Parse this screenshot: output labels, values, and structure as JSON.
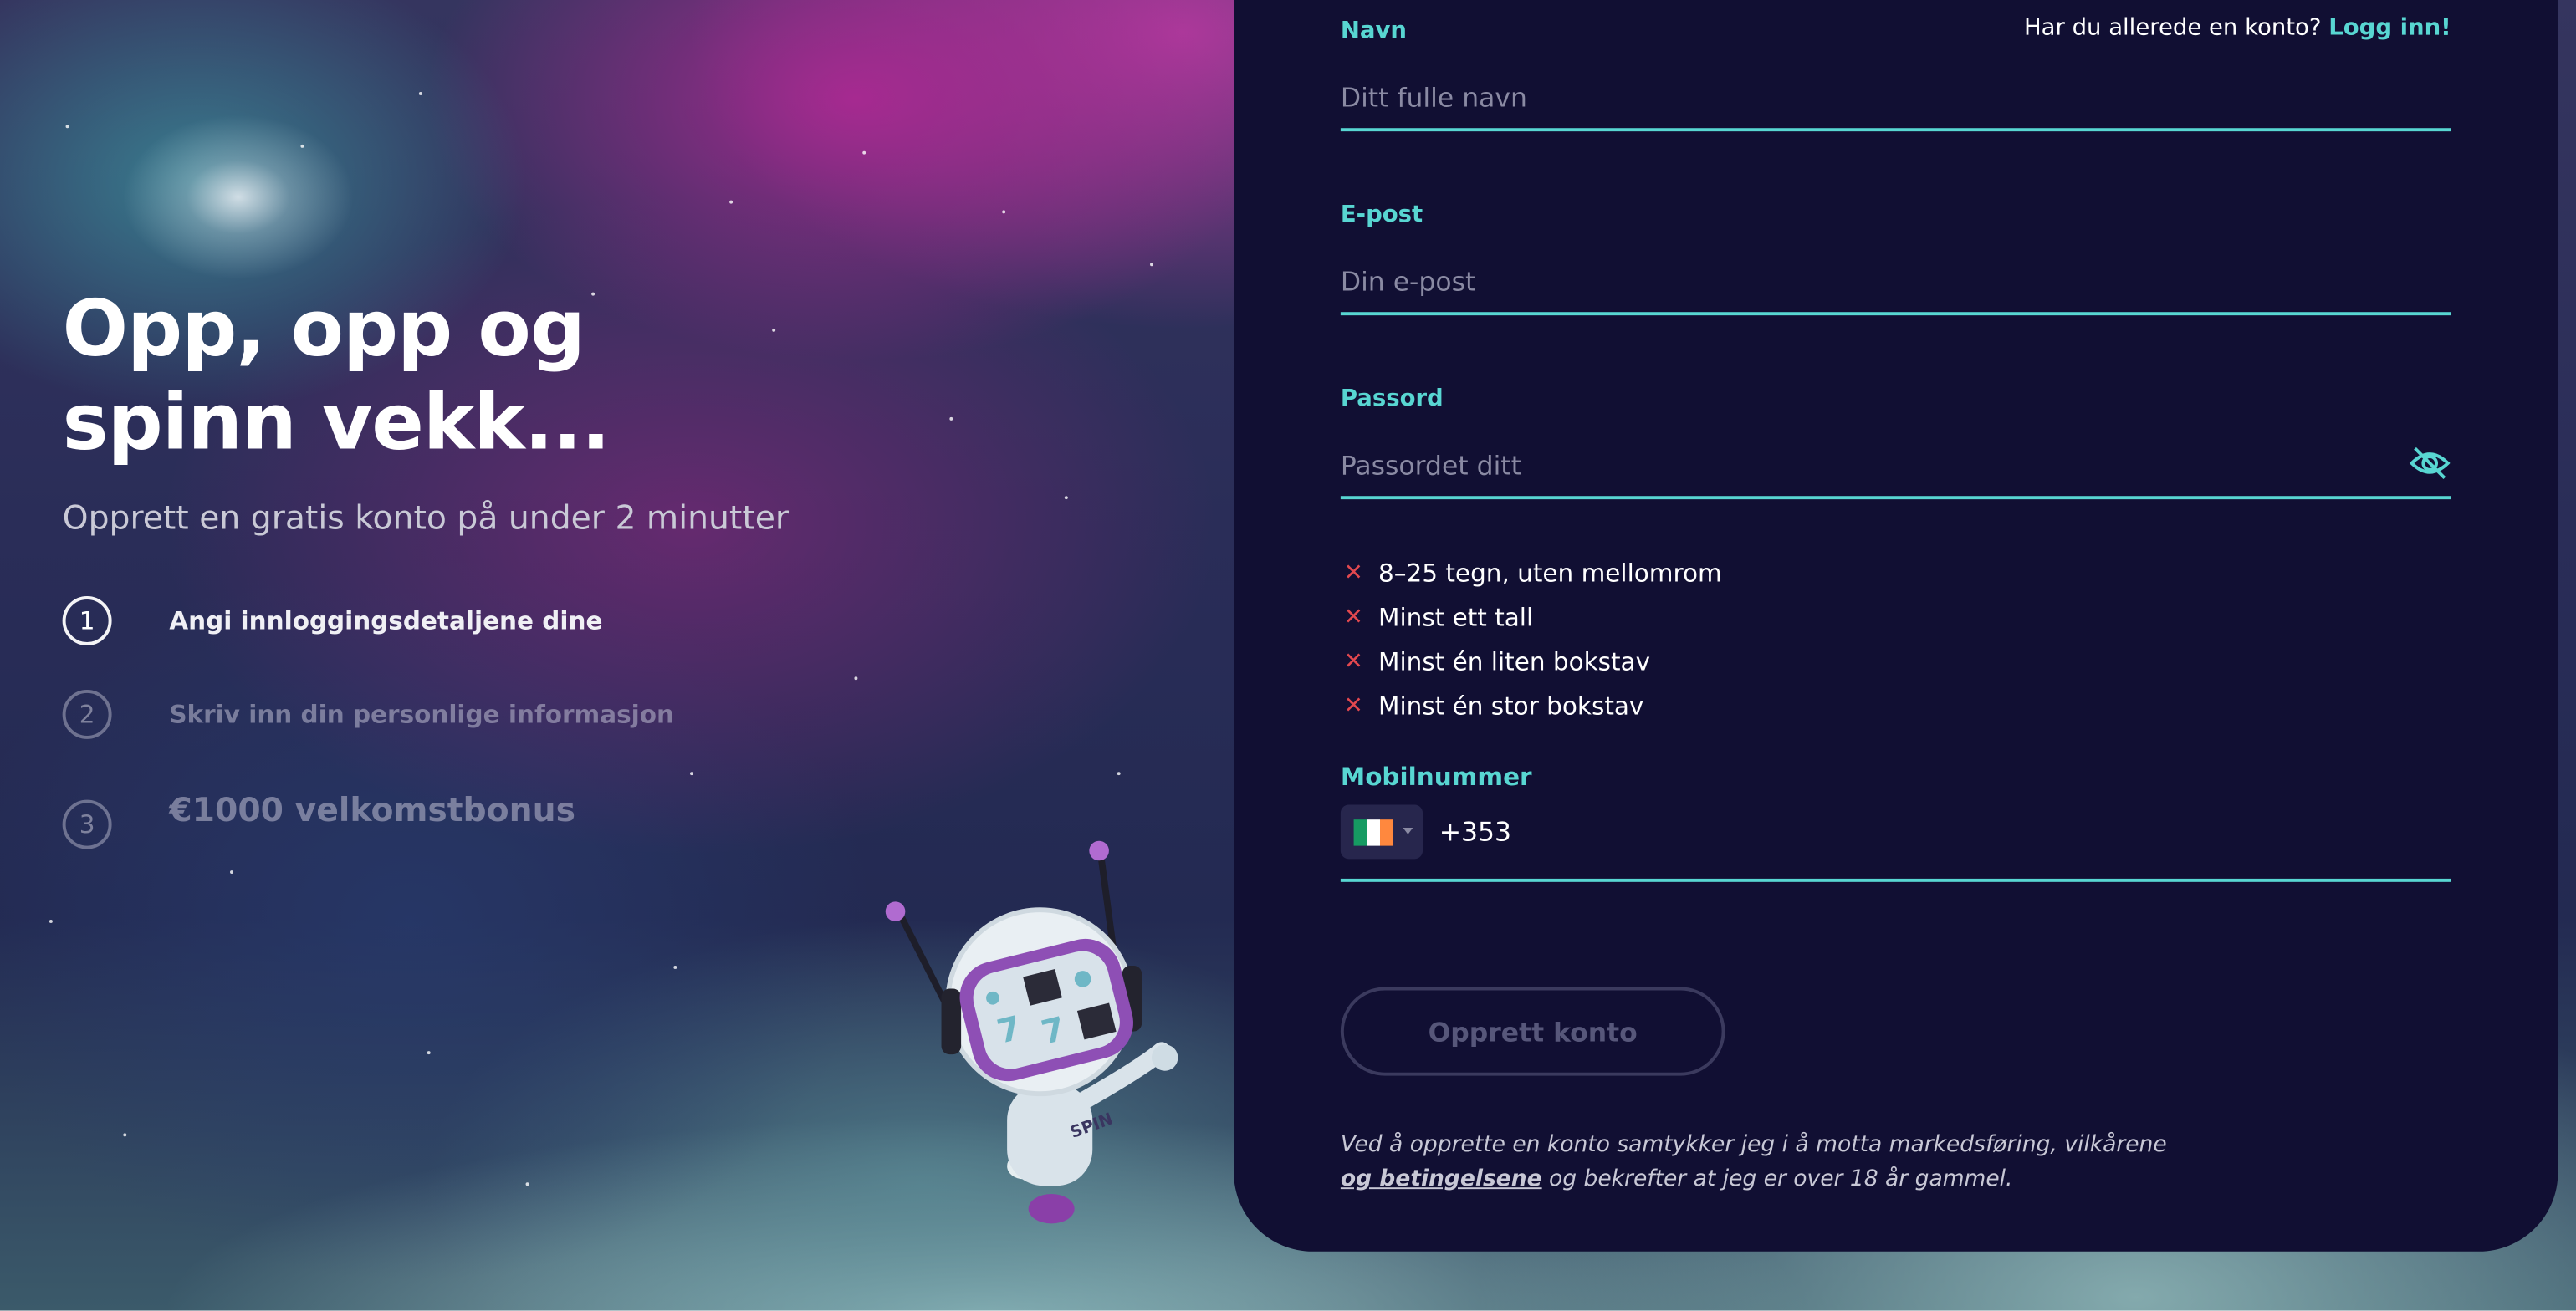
{
  "hero": {
    "title_line1": "Opp, opp og",
    "title_line2": "spinn vekk...",
    "subtitle": "Opprett en gratis konto på under 2 minutter"
  },
  "steps": [
    {
      "number": "1",
      "label": "Angi innloggingsdetaljene dine",
      "active": true
    },
    {
      "number": "2",
      "label": "Skriv inn din personlige informasjon",
      "active": false
    },
    {
      "number": "3",
      "label": "€1000 velkomstbonus",
      "active": false
    }
  ],
  "mascot": {
    "badge_text": "SPIN"
  },
  "login": {
    "prompt": "Har du allerede en konto?",
    "link": "Logg inn!"
  },
  "form": {
    "name": {
      "label": "Navn",
      "placeholder": "Ditt fulle navn"
    },
    "email": {
      "label": "E-post",
      "placeholder": "Din e-post"
    },
    "password": {
      "label": "Passord",
      "placeholder": "Passordet ditt",
      "toggle_icon": "eye-slash-icon"
    },
    "password_rules": [
      "8–25 tegn, uten mellomrom",
      "Minst ett tall",
      "Minst én liten bokstav",
      "Minst én stor bokstav"
    ],
    "rule_status_icon": "cross-icon",
    "phone": {
      "label": "Mobilnummer",
      "dial_code": "+353",
      "country_flag": "ireland-flag"
    },
    "submit_label": "Opprett konto",
    "terms_before": "Ved å opprette en konto samtykker jeg i å motta markedsføring, vilkårene ",
    "terms_link": "og betingelsene",
    "terms_after": " og bekrefter at jeg er over 18 år gammel."
  },
  "colors": {
    "accent": "#58d6d2",
    "panel_bg": "#110f33",
    "error": "#e2484f",
    "flag_green": "#169b62",
    "flag_white": "#ffffff",
    "flag_orange": "#ff883e"
  }
}
